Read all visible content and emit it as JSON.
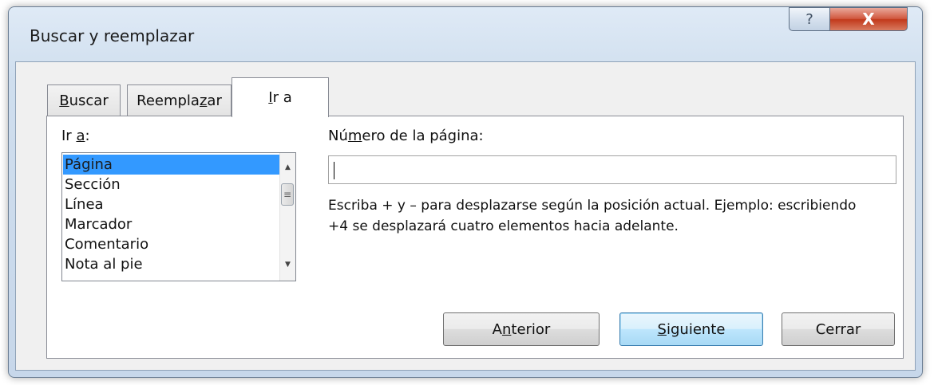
{
  "window": {
    "title": "Buscar y reemplazar",
    "help_glyph": "?",
    "close_glyph": "X"
  },
  "tabs": [
    {
      "label_pre": "",
      "label_accel": "B",
      "label_post": "uscar",
      "active": false
    },
    {
      "label_pre": "Reempla",
      "label_accel": "z",
      "label_post": "ar",
      "active": false
    },
    {
      "label_pre": "",
      "label_accel": "I",
      "label_post": "r a",
      "active": true
    }
  ],
  "goto": {
    "label_pre": "Ir ",
    "label_accel": "a",
    "label_post": ":",
    "items": [
      "Página",
      "Sección",
      "Línea",
      "Marcador",
      "Comentario",
      "Nota al pie"
    ],
    "selected": "Página"
  },
  "page_number": {
    "label_pre": "Nú",
    "label_accel": "m",
    "label_post": "ero de la página:",
    "value": "",
    "hint": "Escriba + y – para desplazarse según la posición actual. Ejemplo: escribiendo +4 se desplazará cuatro elementos hacia adelante."
  },
  "buttons": {
    "anterior": {
      "pre": "A",
      "accel": "n",
      "post": "terior"
    },
    "siguiente": {
      "pre": "",
      "accel": "S",
      "post": "iguiente"
    },
    "cerrar": "Cerrar"
  },
  "colors": {
    "selection": "#3399ff",
    "default_button_border": "#3c7fb1"
  }
}
